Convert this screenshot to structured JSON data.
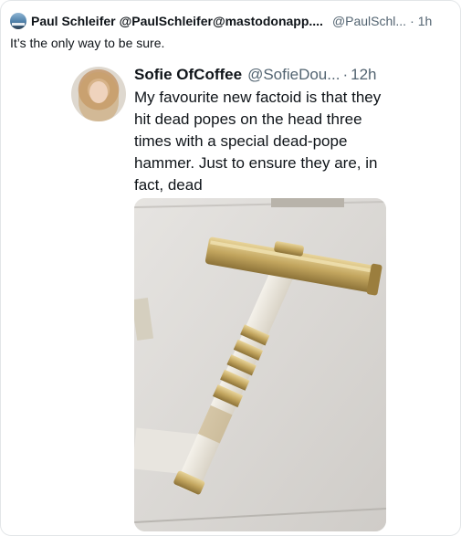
{
  "outer_post": {
    "display_name": "Paul Schleifer",
    "handle_full": "@PaulSchleifer@mastodonapp....",
    "handle_short": "@PaulSchl...",
    "separator": "·",
    "time": "1h",
    "text": "It’s the only way to be sure."
  },
  "quoted_post": {
    "display_name": "Sofie OfCoffee",
    "handle": "@SofieDou...",
    "separator": "·",
    "time": "12h",
    "text": "My favourite new factoid is that they hit dead popes on the head three times with a special dead-pope hammer. Just to ensure they are, in fact, dead",
    "media": {
      "description": "ornate ceremonial hammer with gilded head and ivory handle in a display case"
    }
  },
  "icons": [
    "avatar",
    "avatar"
  ],
  "colors": {
    "text_primary": "#0f1419",
    "text_secondary": "#536471",
    "border": "#e3e6e8"
  }
}
